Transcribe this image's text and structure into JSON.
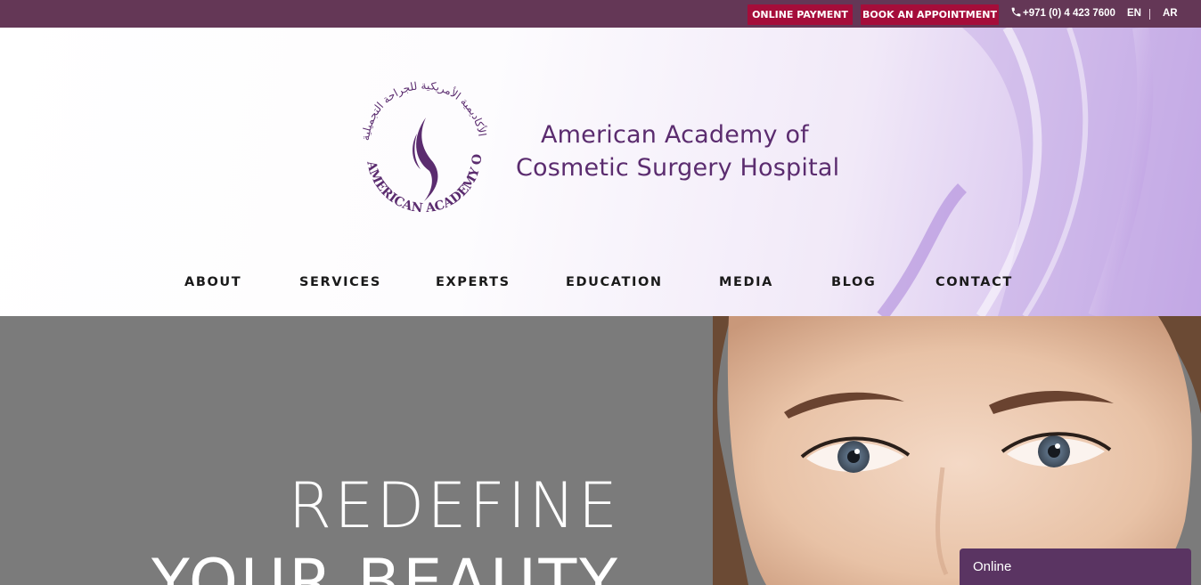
{
  "topbar": {
    "online_payment": "ONLINE PAYMENT",
    "book_appointment": "BOOK AN APPOINTMENT",
    "phone": "+971 (0) 4 423 7600",
    "lang_en": "EN",
    "lang_ar": "AR"
  },
  "logo": {
    "line1": "American Academy of",
    "line2": "Cosmetic Surgery Hospital",
    "emblem_text": "AMERICAN ACADEMY OF COSMETIC SURGERY HOSPITAL"
  },
  "nav": {
    "items": [
      {
        "label": "ABOUT"
      },
      {
        "label": "SERVICES"
      },
      {
        "label": "EXPERTS"
      },
      {
        "label": "EDUCATION"
      },
      {
        "label": "MEDIA"
      },
      {
        "label": "BLOG"
      },
      {
        "label": "CONTACT"
      }
    ]
  },
  "hero": {
    "line1": "REDEFINE",
    "line2": "YOUR BEAUTY"
  },
  "chat": {
    "status": "Online"
  },
  "colors": {
    "topbar": "#643756",
    "button": "#a50d3a",
    "brand_purple": "#5b2c6f",
    "hero_bg": "#7b7b7b",
    "chat": "#5a3462"
  },
  "icons": [
    "phone-icon"
  ]
}
